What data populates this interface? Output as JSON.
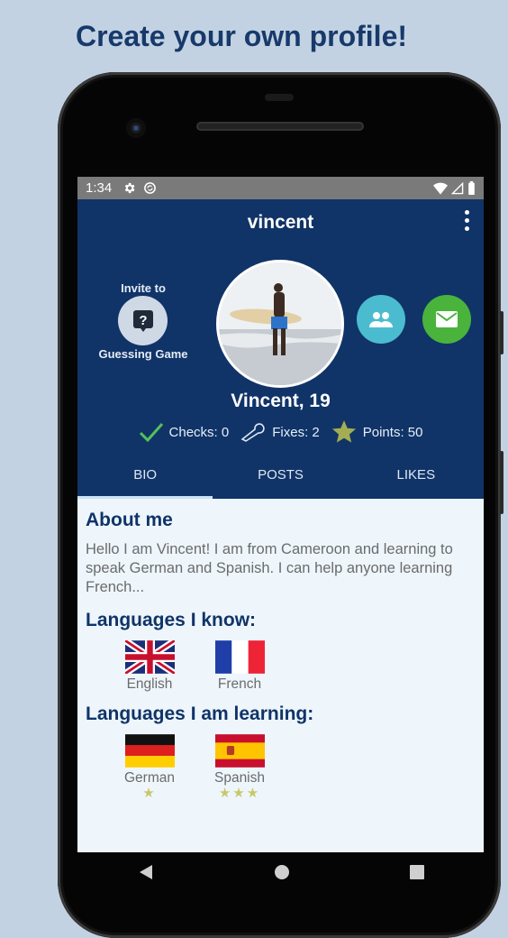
{
  "headline": "Create your own profile!",
  "status_bar": {
    "time": "1:34"
  },
  "app_bar": {
    "title": "vincent"
  },
  "invite": {
    "line1": "Invite to",
    "line2": "Guessing Game"
  },
  "profile": {
    "name": "Vincent, 19",
    "stats": [
      {
        "icon": "check-icon",
        "label": "Checks: 0"
      },
      {
        "icon": "wrench-icon",
        "label": "Fixes: 2"
      },
      {
        "icon": "star-icon",
        "label": "Points: 50"
      }
    ]
  },
  "tabs": [
    {
      "label": "BIO",
      "active": true
    },
    {
      "label": "POSTS",
      "active": false
    },
    {
      "label": "LIKES",
      "active": false
    }
  ],
  "about": {
    "title": "About me",
    "text": "Hello I am Vincent! I am from Cameroon and learning to speak German and Spanish. I can help anyone learning French..."
  },
  "languages_known": {
    "title": "Languages I know:",
    "items": [
      {
        "name": "English",
        "flag": "uk-flag-icon"
      },
      {
        "name": "French",
        "flag": "france-flag-icon"
      }
    ]
  },
  "languages_learning": {
    "title": "Languages I am learning:",
    "items": [
      {
        "name": "German",
        "flag": "germany-flag-icon",
        "level": 1,
        "stars": "★"
      },
      {
        "name": "Spanish",
        "flag": "spain-flag-icon",
        "level": 3,
        "stars": "★★★"
      }
    ]
  },
  "colors": {
    "header": "#103468",
    "friends_button": "#4bbcd0",
    "mail_button": "#4ab33c",
    "star": "#c8c86a",
    "background": "#c3d2e2"
  }
}
